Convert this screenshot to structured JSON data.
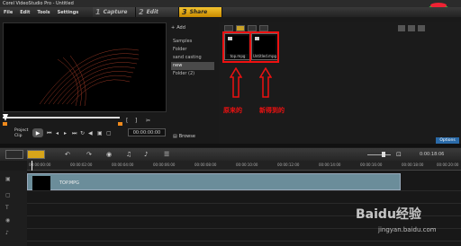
{
  "window": {
    "title": "Corel VideoStudio Pro - Untitled"
  },
  "menu": [
    "File",
    "Edit",
    "Tools",
    "Settings"
  ],
  "steps": [
    {
      "num": "1",
      "label": "Capture"
    },
    {
      "num": "2",
      "label": "Edit"
    },
    {
      "num": "3",
      "label": "Share"
    }
  ],
  "preview": {
    "project_label": "Project",
    "clip_label": "Clip",
    "timecode": "00:00:00:00"
  },
  "library": {
    "add_label": "Add",
    "folders": [
      "Samples",
      "Folder",
      "sand casting",
      "new",
      "Folder (2)"
    ],
    "selected_folder_index": 3,
    "browse_label": "Browse",
    "options_label": "Options",
    "clips": [
      {
        "name": "top.mpg"
      },
      {
        "name": "Untitled.mpg"
      }
    ],
    "annotations": {
      "original": "原来的",
      "new": "新得到的"
    }
  },
  "timeline": {
    "timecode": "0:00:18:06",
    "ruler_ticks": [
      "00:00:00:00",
      "00:00:02:00",
      "00:00:04:00",
      "00:00:06:00",
      "00:00:08:00",
      "00:00:10:00",
      "00:00:12:00",
      "00:00:14:00",
      "00:00:16:00",
      "00:00:18:00",
      "00:00:20:00"
    ],
    "clip_label": "TOP.MPG"
  },
  "watermark": {
    "brand": "Baidu经验",
    "url": "jingyan.baidu.com"
  },
  "colors": {
    "accent": "#d7a51a",
    "highlight": "#e11111",
    "clip_bar": "#6b8d9a"
  }
}
